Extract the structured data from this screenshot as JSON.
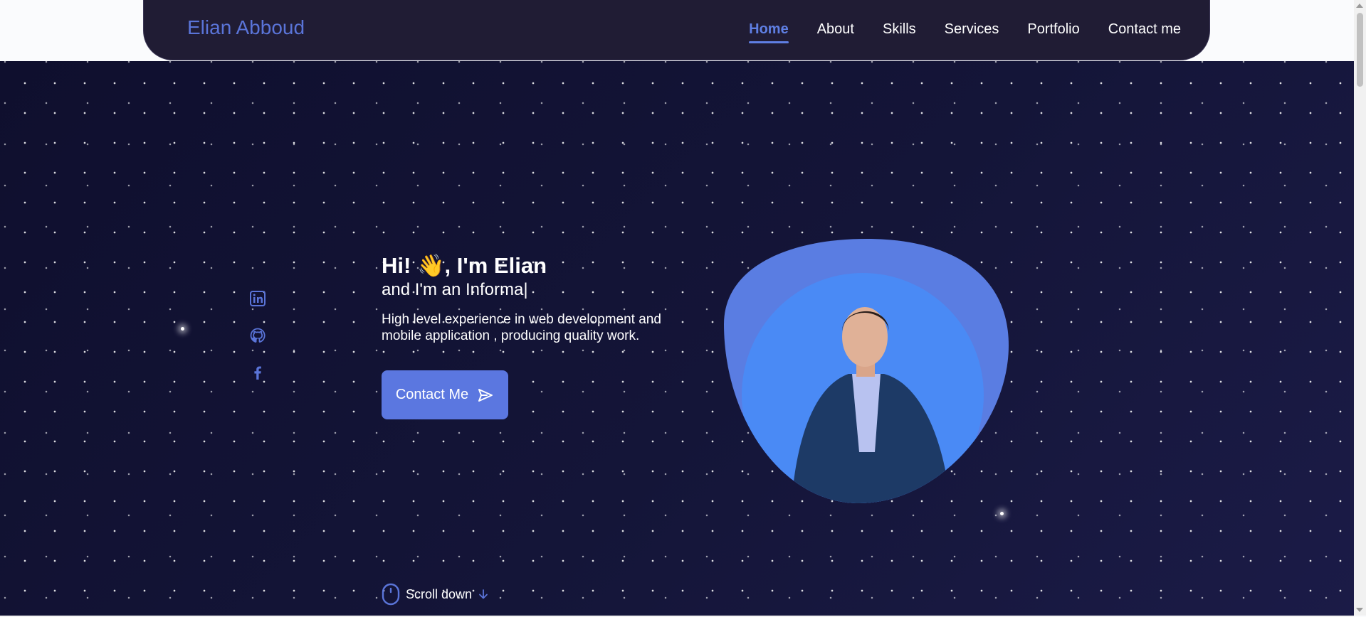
{
  "brand": "Elian Abboud",
  "nav": [
    {
      "label": "Home",
      "active": true
    },
    {
      "label": "About"
    },
    {
      "label": "Skills"
    },
    {
      "label": "Services"
    },
    {
      "label": "Portfolio"
    },
    {
      "label": "Contact me"
    }
  ],
  "social": [
    "linkedin-icon",
    "github-icon",
    "facebook-icon"
  ],
  "hero": {
    "greeting_before": "Hi! ",
    "wave": "👋",
    "greeting_after": ", I'm Elian",
    "subtitle": "and I'm an Informa|",
    "description": "High level experience in web development and mobile application , producing quality work.",
    "button_label": "Contact Me"
  },
  "scroll_label": "Scroll down",
  "colors": {
    "accent": "#5b77e0",
    "navbar_bg": "#201c34",
    "hero_bg": "#141538",
    "blob_outer": "#5a7de2",
    "blob_inner": "#4a8af5"
  }
}
